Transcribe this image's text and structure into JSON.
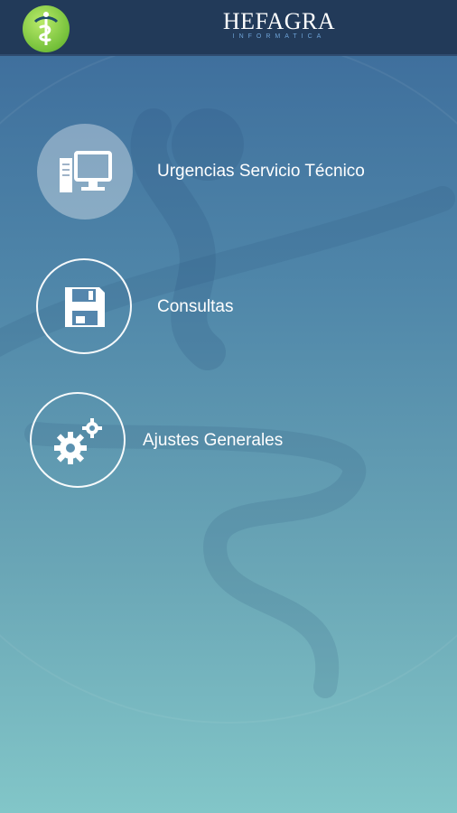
{
  "header": {
    "brand_name": "HEFAGRA",
    "brand_subtitle": "INFORMATICA",
    "logo_icon": "caduceus-logo-icon"
  },
  "menu": [
    {
      "label": "Urgencias Servicio Técnico",
      "icon": "computer-icon",
      "highlighted": true
    },
    {
      "label": "Consultas",
      "icon": "floppy-disk-icon",
      "highlighted": false
    },
    {
      "label": "Ajustes Generales",
      "icon": "gears-icon",
      "highlighted": false
    }
  ],
  "colors": {
    "topbar": "#223a59",
    "accent_green": "#74c03a",
    "gradient_top": "#3b6a9a",
    "gradient_bottom": "#82c6c8"
  }
}
